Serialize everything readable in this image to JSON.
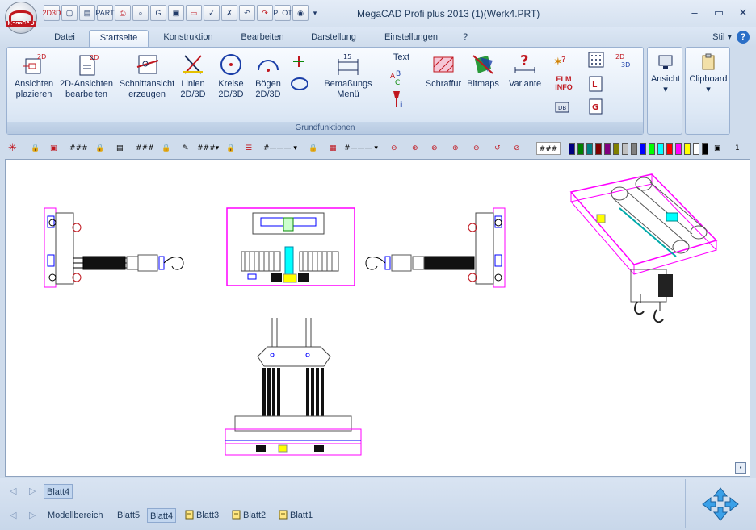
{
  "window": {
    "title": "MegaCAD Profi plus 2013 (1)(Werk4.PRT)",
    "app_logo_text": "MegaCAD",
    "minimize": "–",
    "restore": "▭",
    "close": "✕"
  },
  "qat": [
    {
      "name": "2d3d-toggle",
      "label": "2D3D"
    },
    {
      "name": "new-file",
      "label": "▢"
    },
    {
      "name": "open-file",
      "label": "▤"
    },
    {
      "name": "save-file",
      "label": "PART"
    },
    {
      "name": "print",
      "label": "⎙"
    },
    {
      "name": "preview",
      "label": "⌕"
    },
    {
      "name": "layer",
      "label": "G"
    },
    {
      "name": "mirror",
      "label": "▣"
    },
    {
      "name": "measure",
      "label": "▭"
    },
    {
      "name": "check",
      "label": "✓"
    },
    {
      "name": "delete",
      "label": "✗"
    },
    {
      "name": "undo",
      "label": "↶"
    },
    {
      "name": "redo",
      "label": "↷"
    },
    {
      "name": "plot",
      "label": "PLOT"
    },
    {
      "name": "render",
      "label": "◉"
    }
  ],
  "tabs": [
    "Datei",
    "Startseite",
    "Konstruktion",
    "Bearbeiten",
    "Darstellung",
    "Einstellungen",
    "?"
  ],
  "active_tab": "Startseite",
  "stil_label": "Stil",
  "ribbon": {
    "group_label": "Grundfunktionen",
    "buttons": [
      {
        "line1": "Ansichten",
        "line2": "plazieren"
      },
      {
        "line1": "2D-Ansichten",
        "line2": "bearbeiten"
      },
      {
        "line1": "Schnittansicht",
        "line2": "erzeugen"
      },
      {
        "line1": "Linien",
        "line2": "2D/3D"
      },
      {
        "line1": "Kreise",
        "line2": "2D/3D"
      },
      {
        "line1": "Bögen",
        "line2": "2D/3D"
      },
      {
        "line1": "Bemaßungs",
        "line2": "Menü"
      },
      {
        "line1": "Text",
        "line2": ""
      },
      {
        "line1": "Schraffur",
        "line2": ""
      },
      {
        "line1": "Bitmaps",
        "line2": ""
      },
      {
        "line1": "Variante",
        "line2": ""
      }
    ],
    "elm_info": "ELM INFO",
    "ansicht": "Ansicht",
    "clipboard": "Clipboard"
  },
  "toolbar": {
    "hash": "###",
    "page_number": "1",
    "palette": [
      "#000080",
      "#008000",
      "#008080",
      "#800000",
      "#800080",
      "#808000",
      "#c0c0c0",
      "#808080",
      "#0000ff",
      "#00ff00",
      "#00ffff",
      "#ff0000",
      "#ff00ff",
      "#ffff00",
      "#ffffff",
      "#000000"
    ]
  },
  "accent": {
    "magenta": "#ff00ff",
    "ribbon_border": "#9ab1d1"
  },
  "sheets": {
    "upper_tab": "Blatt4",
    "lower": [
      "Modellbereich",
      "Blatt5",
      "Blatt4",
      "Blatt3",
      "Blatt2",
      "Blatt1"
    ],
    "selected": "Blatt4"
  }
}
